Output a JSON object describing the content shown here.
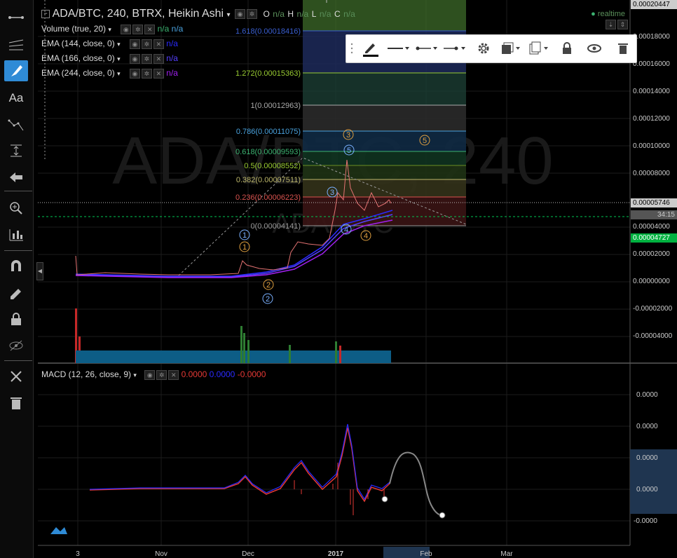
{
  "symbol": {
    "title": "ADA/BTC, 240, BTRX, Heikin Ashi",
    "ohlc_labels": [
      "O",
      "H",
      "L",
      "C"
    ],
    "ohlc_value": "n/a",
    "status": "realtime"
  },
  "watermark": {
    "big": "ADA/BTC, 240",
    "small": "ADA/BTC"
  },
  "indicators": [
    {
      "label": "Volume (true, 20)",
      "values": [
        "n/a",
        "n/a"
      ]
    },
    {
      "label": "EMA (144, close, 0)",
      "values": [
        "n/a"
      ]
    },
    {
      "label": "EMA (166, close, 0)",
      "values": [
        "n/a"
      ]
    },
    {
      "label": "EMA (244, close, 0)",
      "values": [
        "n/a"
      ]
    }
  ],
  "macd": {
    "label": "MACD (12, 26, close, 9)",
    "values": [
      "0.0000",
      "0.0000",
      "-0.0000"
    ]
  },
  "price_axis": [
    "0.00020447",
    "0.00018000",
    "0.00016000",
    "0.00014000",
    "0.00012000",
    "0.00010000",
    "0.00008000",
    "0.00005746",
    "34:15",
    "0.00004000",
    "0.00004727",
    "0.00002000",
    "0.00000000",
    "-0.00002000",
    "-0.00004000"
  ],
  "macd_axis": [
    "0.0000",
    "0.0000",
    "0.0000",
    "0.0000",
    "-0.0000"
  ],
  "time_axis": [
    "3",
    "Nov",
    "Dec",
    "2017",
    "Feb",
    "Mar"
  ],
  "fib_levels": [
    {
      "label": "1.618(0.00018416)",
      "color": "#3a5fd0"
    },
    {
      "label": "1.272(0.00015363)",
      "color": "#9acd32"
    },
    {
      "label": "1(0.00012963)",
      "color": "#aaaaaa"
    },
    {
      "label": "0.786(0.00011075)",
      "color": "#4aa3df"
    },
    {
      "label": "0.618(0.00009593)",
      "color": "#3cb371"
    },
    {
      "label": "0.5(0.00008552)",
      "color": "#6b8e23"
    },
    {
      "label": "0.382(0.00007511)",
      "color": "#bdb76b"
    },
    {
      "label": "0.236(0.00006223)",
      "color": "#d9534f"
    },
    {
      "label": "0(0.00004141)",
      "color": "#999999"
    }
  ],
  "wave_labels": [
    "1",
    "1",
    "2",
    "2",
    "3",
    "3",
    "3",
    "4",
    "4",
    "5",
    "5"
  ],
  "colors": {
    "accent": "#2f8bd6",
    "green": "#00c853",
    "red": "#e53935",
    "bg": "#000000"
  },
  "toolbar_icons": [
    "cursor-icon",
    "lines-icon",
    "brush-icon",
    "text-icon",
    "pattern-icon",
    "measure-icon",
    "back-arrow-icon",
    "zoom-icon",
    "stats-icon",
    "magnet-icon",
    "pencil-lock-icon",
    "lock-icon",
    "eye-off-icon",
    "remove-tools-icon",
    "trash-icon"
  ],
  "float_toolbar_icons": [
    "drag-handle-icon",
    "pen-color-icon",
    "line-style-icon",
    "left-end-icon",
    "right-end-icon",
    "settings-icon",
    "layers-icon",
    "clone-icon",
    "lock-icon",
    "eye-icon",
    "trash-icon"
  ]
}
